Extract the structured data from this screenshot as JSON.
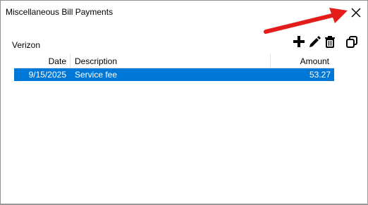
{
  "window": {
    "title": "Miscellaneous Bill Payments",
    "close_icon": "close-icon"
  },
  "account": {
    "name": "Verizon"
  },
  "toolbar": {
    "icons": [
      "plus-icon",
      "pencil-icon",
      "trash-icon",
      "copy-icon"
    ]
  },
  "annotation": {
    "arrow_color": "#e31c1c"
  },
  "table": {
    "columns": [
      "Date",
      "Description",
      "Amount"
    ],
    "rows": [
      {
        "date": "9/15/2025",
        "description": "Service fee",
        "amount": "53.27"
      }
    ],
    "selection_color": "#0078d7"
  }
}
